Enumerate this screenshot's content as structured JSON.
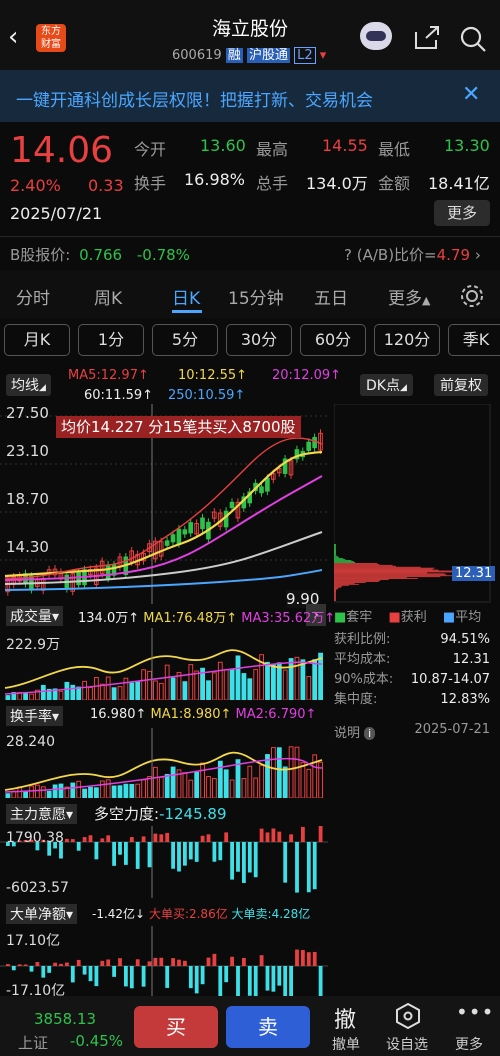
{
  "header": {
    "name": "海立股份",
    "code": "600619",
    "badge_rong": "融",
    "badge_hgt": "沪股通",
    "badge_l2": "L2",
    "logo_line1": "东方",
    "logo_line2": "财富"
  },
  "banner": {
    "text": "一键开通科创成长层权限！把握打新、交易机会"
  },
  "quote": {
    "price": "14.06",
    "pct": "2.40%",
    "change": "0.33",
    "date": "2025/07/21",
    "open_label": "今开",
    "open": "13.60",
    "high_label": "最高",
    "high": "14.55",
    "low_label": "最低",
    "low": "13.30",
    "turnover_label": "换手",
    "turnover": "16.98%",
    "vol_label": "总手",
    "vol": "134.0万",
    "amount_label": "金额",
    "amount": "18.41亿",
    "more": "更多",
    "bshare_label": "B股报价:",
    "bshare_price": "0.766",
    "bshare_pct": "-0.78%",
    "ab_label": "(A/B)比价=",
    "ab_value": "4.79"
  },
  "tabs": [
    "分时",
    "周K",
    "日K",
    "15分钟",
    "五日",
    "更多"
  ],
  "ktabs": [
    "月K",
    "1分",
    "5分",
    "30分",
    "60分",
    "120分",
    "季K"
  ],
  "ma": {
    "btn": "均线",
    "ma5": "MA5:12.97↑",
    "ma10": "10:12.55↑",
    "ma20": "20:12.09↑",
    "ma60": "60:11.59↑",
    "ma250": "250:10.59↑",
    "dk": "DK点",
    "fq": "前复权"
  },
  "kchart": {
    "y1": "27.50",
    "y2": "23.10",
    "y3": "18.70",
    "y4": "14.30",
    "y5": "9.90",
    "low_tag": "9.90",
    "tooltip": "均价14.227  分15笔共买入8700股",
    "price_tag": "12.31"
  },
  "legend": {
    "tao": "套牢",
    "huo": "获利",
    "avg": "平均"
  },
  "chips": {
    "rows": [
      {
        "k": "获利比例:",
        "v": "94.51%"
      },
      {
        "k": "平均成本:",
        "v": "12.31"
      },
      {
        "k": "90%成本:",
        "v": "10.87-14.07"
      },
      {
        "k": "集中度:",
        "v": "12.83%"
      }
    ],
    "note_label": "说明",
    "note_date": "2025-07-21"
  },
  "vol": {
    "title": "成交量",
    "v": "134.0万↑",
    "ma1": "MA1:76.48万↑",
    "ma3": "MA3:35.62万↑",
    "ymax": "222.9万"
  },
  "hsl": {
    "title": "换手率",
    "v": "16.980↑",
    "ma1": "MA1:8.980↑",
    "ma2": "MA2:6.790↑",
    "ymax": "28.240"
  },
  "zlyy": {
    "title": "主力意愿",
    "extra": "多空力度:",
    "val": "-1245.89",
    "ymax": "1790.38",
    "ymin": "-6023.57"
  },
  "ddje": {
    "title": "大单净额",
    "v": "-1.42亿↓",
    "buy": "大单买:2.86亿",
    "sell": "大单卖:4.28亿",
    "ymax": "17.10亿",
    "ymin": "-17.10亿"
  },
  "footer": {
    "index": "3858.13",
    "index_name": "上证",
    "index_pct": "-0.45%",
    "buy": "买",
    "sell": "卖",
    "cancel": "撤单",
    "cancel_icon": "撤",
    "watch": "设自选",
    "more": "更多"
  }
}
